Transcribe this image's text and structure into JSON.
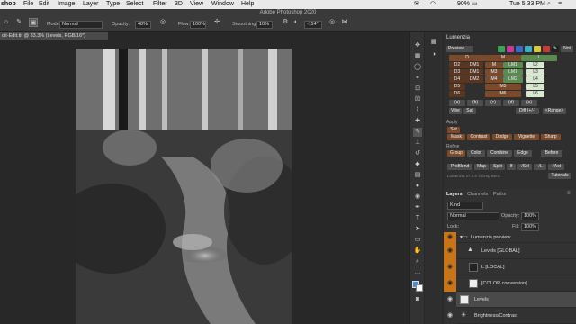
{
  "menubar": {
    "app": "shop",
    "items": [
      "File",
      "Edit",
      "Image",
      "Layer",
      "Type",
      "Select",
      "Filter",
      "3D",
      "View",
      "Window",
      "Help"
    ],
    "battery": "90%",
    "clock": "Tue 5:33 PM"
  },
  "window_title": "Adobe Photoshop 2020",
  "options": {
    "mode_label": "Mode:",
    "mode_value": "Normal",
    "opacity_label": "Opacity:",
    "opacity_value": "48%",
    "flow_label": "Flow:",
    "flow_value": "100%",
    "smoothing_label": "Smoothing:",
    "smoothing_value": "10%",
    "angle_value": "-114°"
  },
  "doc_tab": "dit-Edit.tif @ 33.3% (Levels, RGB/16*)",
  "lumenzia": {
    "title": "Lumenzia",
    "preview_label": "Preview",
    "not_label": "Not",
    "rows": [
      [
        "D",
        "M",
        "L"
      ],
      [
        "D2",
        "DM1",
        "M",
        "LM1",
        "L2"
      ],
      [
        "D3",
        "DM1",
        "M3",
        "LM1",
        "L3"
      ],
      [
        "D4",
        "DM2",
        "M4",
        "LM2",
        "L4"
      ],
      [
        "D5",
        "M5",
        "L5"
      ],
      [
        "D6",
        "M6",
        "L6"
      ]
    ],
    "zone_row": [
      "(a)",
      "(b)",
      "(c)",
      "(d)",
      "(e)"
    ],
    "vibe_label": "Vibe",
    "sat_label": "Sat",
    "diff_label": "Diff (+/-)",
    "range_label": "<Range>",
    "apply_label": "Apply",
    "set_label": "Set",
    "mask_buttons": [
      "Mask",
      "Contrast",
      "Dodge",
      "Vignette",
      "Sharp"
    ],
    "refine_label": "Refine",
    "refine_buttons": [
      "Group",
      "Color",
      "Combine",
      "Edge",
      "Before"
    ],
    "util_buttons": [
      "PreBlend",
      "Map",
      "Split",
      "If",
      "√Sel",
      "√L",
      "√Act"
    ],
    "credit": "Lumenzia v7.0.0 ©Greg Benz",
    "tutorials": "Tutorials"
  },
  "layers_panel": {
    "tabs": [
      "Layers",
      "Channels",
      "Paths"
    ],
    "kind": "Kind",
    "blend": "Normal",
    "opacity_label": "Opacity:",
    "opacity_value": "100%",
    "lock_label": "Lock:",
    "fill_label": "Fill:",
    "fill_value": "100%",
    "layers": [
      {
        "name": "Lumenzia preview"
      },
      {
        "name": "Levels [GLOBAL]"
      },
      {
        "name": "L [LOCAL]"
      },
      {
        "name": "[COLOR conversion]"
      },
      {
        "name": "Levels"
      },
      {
        "name": "Brightness/Contrast"
      }
    ]
  },
  "colors": {
    "accent": "#c8741a",
    "panel": "#323232",
    "menubar": "#e9e9e9"
  }
}
